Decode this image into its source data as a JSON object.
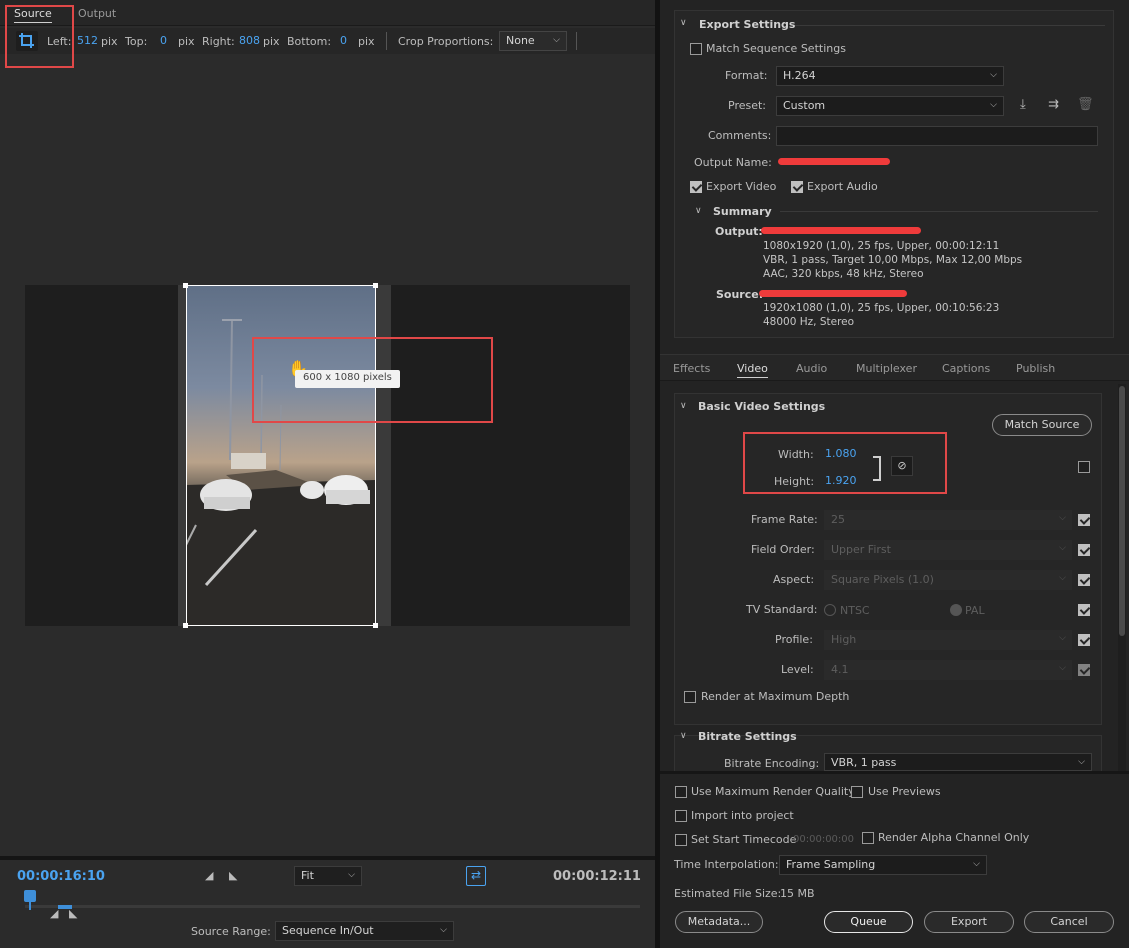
{
  "source_panel": {
    "tabs": [
      "Source",
      "Output"
    ],
    "crop": {
      "left_label": "Left:",
      "left_value": "512",
      "left_unit": "pix",
      "top_label": "Top:",
      "top_value": "0",
      "top_unit": "pix",
      "right_label": "Right:",
      "right_value": "808",
      "right_unit": "pix",
      "bottom_label": "Bottom:",
      "bottom_value": "0",
      "bottom_unit": "pix",
      "proportions_label": "Crop Proportions:",
      "proportions_value": "None"
    },
    "tooltip": "600 x 1080 pixels",
    "timecode_current": "00:00:16:10",
    "timecode_duration": "00:00:12:11",
    "zoom": "Fit",
    "source_range_label": "Source Range:",
    "source_range_value": "Sequence In/Out"
  },
  "export_settings": {
    "title": "Export Settings",
    "match_sequence": "Match Sequence Settings",
    "format_label": "Format:",
    "format_value": "H.264",
    "preset_label": "Preset:",
    "preset_value": "Custom",
    "comments_label": "Comments:",
    "comments_value": "",
    "output_name_label": "Output Name:",
    "export_video": "Export Video",
    "export_audio": "Export Audio",
    "summary_title": "Summary",
    "output_label": "Output:",
    "output_lines": [
      "1080x1920 (1,0), 25 fps, Upper, 00:00:12:11",
      "VBR, 1 pass, Target 10,00 Mbps, Max 12,00 Mbps",
      "AAC, 320 kbps, 48 kHz, Stereo"
    ],
    "source_label": "Source:",
    "source_lines": [
      "1920x1080 (1,0), 25 fps, Upper, 00:10:56:23",
      "48000 Hz, Stereo"
    ]
  },
  "settings_tabs": [
    "Effects",
    "Video",
    "Audio",
    "Multiplexer",
    "Captions",
    "Publish"
  ],
  "video": {
    "basic_title": "Basic Video Settings",
    "match_source": "Match Source",
    "width_label": "Width:",
    "width_value": "1.080",
    "height_label": "Height:",
    "height_value": "1.920",
    "frame_rate_label": "Frame Rate:",
    "frame_rate_value": "25",
    "field_order_label": "Field Order:",
    "field_order_value": "Upper First",
    "aspect_label": "Aspect:",
    "aspect_value": "Square Pixels (1.0)",
    "tv_standard_label": "TV Standard:",
    "ntsc": "NTSC",
    "pal": "PAL",
    "profile_label": "Profile:",
    "profile_value": "High",
    "level_label": "Level:",
    "level_value": "4.1",
    "render_max_depth": "Render at Maximum Depth",
    "bitrate_title": "Bitrate Settings",
    "bitrate_encoding_label": "Bitrate Encoding:",
    "bitrate_encoding_value": "VBR, 1 pass"
  },
  "bottom": {
    "max_render_quality": "Use Maximum Render Quality",
    "use_previews": "Use Previews",
    "import_into_project": "Import into project",
    "set_start_timecode": "Set Start Timecode",
    "start_timecode_value": "00:00:00:00",
    "render_alpha": "Render Alpha Channel Only",
    "time_interp_label": "Time Interpolation:",
    "time_interp_value": "Frame Sampling",
    "file_size_label": "Estimated File Size:",
    "file_size_value": "15 MB",
    "metadata": "Metadata...",
    "queue": "Queue",
    "export": "Export",
    "cancel": "Cancel"
  },
  "colors": {
    "accent": "#4aa3f0",
    "annotation_red": "#e04848"
  }
}
